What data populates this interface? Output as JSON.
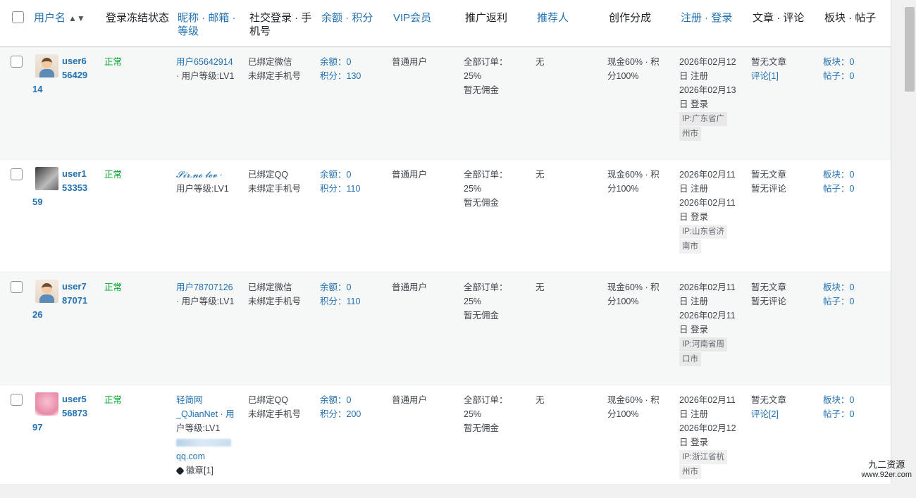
{
  "headers": {
    "username": "用户名",
    "freeze": "登录冻结状态",
    "nickname": "昵称 · 邮箱 · 等级",
    "social": "社交登录 · 手机号",
    "balance": "余额 · 积分",
    "vip": "VIP会员",
    "promo": "推广返利",
    "referrer": "推荐人",
    "creator": "创作分成",
    "register": "注册 · 登录",
    "articles": "文章 · 评论",
    "forum": "板块 · 帖子"
  },
  "sort_icon": "▲▼",
  "rows": [
    {
      "avatar": "male-avatar",
      "user_a": "user6",
      "user_b": "56429",
      "user_c": "14",
      "status": "正常",
      "nick_1": "用户65642914",
      "nick_2": "· 用户等级:LV1",
      "social_1": "已绑定微信",
      "social_2": "未绑定手机号",
      "balance": "余额：0",
      "points": "积分：130",
      "vip": "普通用户",
      "promo_1": "全部订单：",
      "promo_2": "25%",
      "promo_3": "暂无佣金",
      "referrer": "无",
      "creator_1": "现金60% · 积",
      "creator_2": "分100%",
      "reg_1": "2026年02月12",
      "reg_2": "日 注册",
      "login_1": "2026年02月13",
      "login_2": "日 登录",
      "ip_1": "IP:广东省广",
      "ip_2": "州市",
      "art": "暂无文章",
      "cmt": "评论[1]",
      "board": "板块：0",
      "post": "帖子：0"
    },
    {
      "avatar": "photo-avatar",
      "user_a": "user1",
      "user_b": "53353",
      "user_c": "59",
      "status": "正常",
      "nick_1": "𝓢𝓲𝓻.𝓷𝓸 𝓵𝓸𝓿 ·",
      "nick_2": "用户等级:LV1",
      "social_1": "已绑定QQ",
      "social_2": "未绑定手机号",
      "balance": "余额：0",
      "points": "积分：110",
      "vip": "普通用户",
      "promo_1": "全部订单：",
      "promo_2": "25%",
      "promo_3": "暂无佣金",
      "referrer": "无",
      "creator_1": "现金60% · 积",
      "creator_2": "分100%",
      "reg_1": "2026年02月11",
      "reg_2": "日 注册",
      "login_1": "2026年02月11",
      "login_2": "日 登录",
      "ip_1": "IP:山东省济",
      "ip_2": "南市",
      "art": "暂无文章",
      "cmt": "暂无评论",
      "board": "板块：0",
      "post": "帖子：0"
    },
    {
      "avatar": "male-avatar",
      "user_a": "user7",
      "user_b": "87071",
      "user_c": "26",
      "status": "正常",
      "nick_1": "用户78707126",
      "nick_2": "· 用户等级:LV1",
      "social_1": "已绑定微信",
      "social_2": "未绑定手机号",
      "balance": "余额：0",
      "points": "积分：110",
      "vip": "普通用户",
      "promo_1": "全部订单：",
      "promo_2": "25%",
      "promo_3": "暂无佣金",
      "referrer": "无",
      "creator_1": "现金60% · 积",
      "creator_2": "分100%",
      "reg_1": "2026年02月11",
      "reg_2": "日 注册",
      "login_1": "2026年02月11",
      "login_2": "日 登录",
      "ip_1": "IP:河南省周",
      "ip_2": "口市",
      "art": "暂无文章",
      "cmt": "暂无评论",
      "board": "板块：0",
      "post": "帖子：0"
    },
    {
      "avatar": "flower-avatar",
      "user_a": "user5",
      "user_b": "56873",
      "user_c": "97",
      "status": "正常",
      "nick_1": "轻简网",
      "nick_2": "_QJianNet · 用",
      "nick_3": "户等级:LV1",
      "email_tail": "qq.com",
      "badge": "徽章[1]",
      "social_1": "已绑定QQ",
      "social_2": "未绑定手机号",
      "balance": "余额：0",
      "points": "积分：200",
      "vip": "普通用户",
      "promo_1": "全部订单：",
      "promo_2": "25%",
      "promo_3": "暂无佣金",
      "referrer": "无",
      "creator_1": "现金60% · 积",
      "creator_2": "分100%",
      "reg_1": "2026年02月11",
      "reg_2": "日 注册",
      "login_1": "2026年02月12",
      "login_2": "日 登录",
      "ip_1": "IP:浙江省杭",
      "ip_2": "州市",
      "art": "暂无文章",
      "cmt": "评论[2]",
      "board": "板块：0",
      "post": "帖子：0"
    }
  ],
  "watermark": {
    "line1": "九二资源",
    "line2": "www.92er.com"
  }
}
